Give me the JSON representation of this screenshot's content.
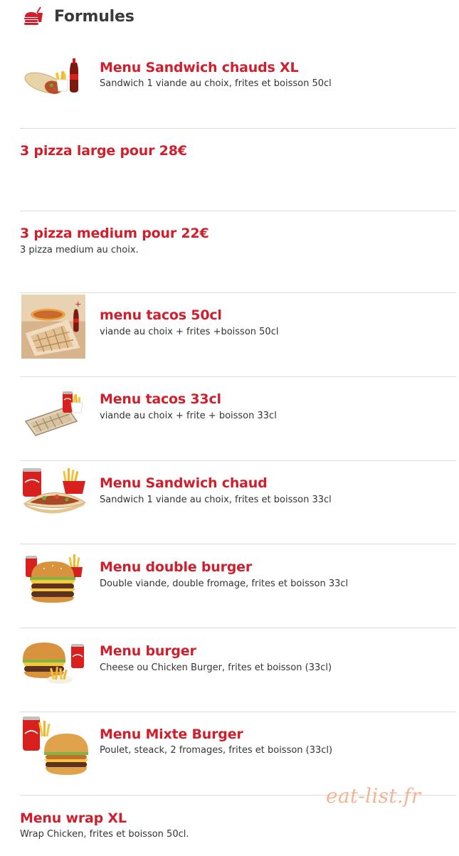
{
  "section": {
    "icon": "fast-food-icon",
    "title": "Formules"
  },
  "items": [
    {
      "name": "Menu Sandwich chauds XL",
      "desc": "Sandwich 1 viande au choix, frites et boisson 50cl",
      "image": "sandwich-xl-image"
    },
    {
      "name": "3 pizza large pour 28€",
      "desc": "",
      "image": ""
    },
    {
      "name": "3 pizza medium pour 22€",
      "desc": "3 pizza medium au choix.",
      "image": ""
    },
    {
      "name": "menu tacos 50cl",
      "desc": "viande au choix + frites +boisson 50cl",
      "image": "tacos-50cl-image"
    },
    {
      "name": "Menu tacos 33cl",
      "desc": "viande au choix + frite + boisson 33cl",
      "image": "tacos-33cl-image"
    },
    {
      "name": "Menu Sandwich chaud",
      "desc": "Sandwich 1 viande au choix, frites et boisson 33cl",
      "image": "sandwich-chaud-image"
    },
    {
      "name": "Menu double burger",
      "desc": "Double viande, double fromage, frites et boisson 33cl",
      "image": "double-burger-image"
    },
    {
      "name": "Menu burger",
      "desc": "Cheese ou Chicken Burger, frites et boisson (33cl)",
      "image": "burger-image"
    },
    {
      "name": "Menu Mixte Burger",
      "desc": "Poulet, steack, 2 fromages, frites et boisson (33cl)",
      "image": "mixte-burger-image"
    },
    {
      "name": "Menu wrap XL",
      "desc": "Wrap Chicken, frites et boisson 50cl.",
      "image": ""
    }
  ],
  "watermark": "eat-list.fr",
  "colors": {
    "item_name": "#d01f2c",
    "header_text": "#3a3a3a",
    "separator": "#dedbd0",
    "watermark": "#f2b596"
  }
}
